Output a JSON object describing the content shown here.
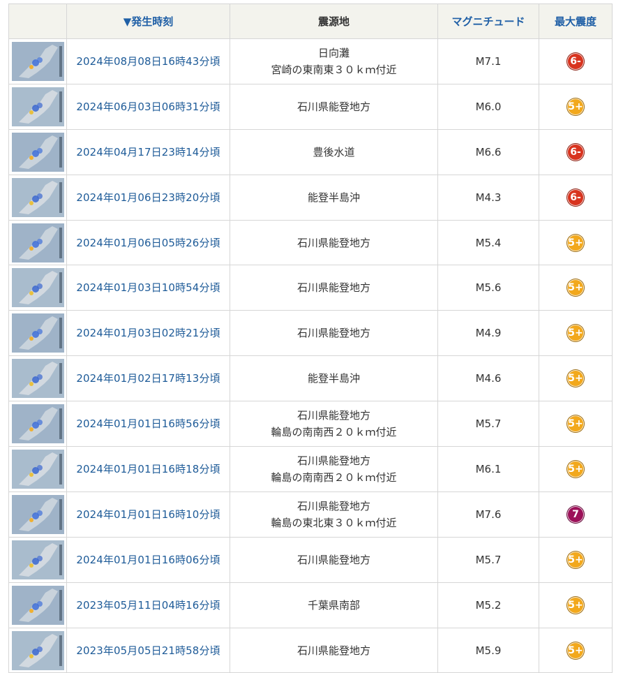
{
  "headers": {
    "thumb": "",
    "time": "▼発生時刻",
    "location": "震源地",
    "magnitude": "マグニチュード",
    "intensity": "最大震度"
  },
  "colors": {
    "6-": "#d8341f",
    "5+": "#f2a81c",
    "7": "#9c1159"
  },
  "rows": [
    {
      "time": "2024年08月08日16時43分頃",
      "location": [
        "日向灘",
        "宮崎の東南東３０ｋｍ付近"
      ],
      "magnitude": "M7.1",
      "intensity": "6-"
    },
    {
      "time": "2024年06月03日06時31分頃",
      "location": [
        "石川県能登地方"
      ],
      "magnitude": "M6.0",
      "intensity": "5+"
    },
    {
      "time": "2024年04月17日23時14分頃",
      "location": [
        "豊後水道"
      ],
      "magnitude": "M6.6",
      "intensity": "6-"
    },
    {
      "time": "2024年01月06日23時20分頃",
      "location": [
        "能登半島沖"
      ],
      "magnitude": "M4.3",
      "intensity": "6-"
    },
    {
      "time": "2024年01月06日05時26分頃",
      "location": [
        "石川県能登地方"
      ],
      "magnitude": "M5.4",
      "intensity": "5+"
    },
    {
      "time": "2024年01月03日10時54分頃",
      "location": [
        "石川県能登地方"
      ],
      "magnitude": "M5.6",
      "intensity": "5+"
    },
    {
      "time": "2024年01月03日02時21分頃",
      "location": [
        "石川県能登地方"
      ],
      "magnitude": "M4.9",
      "intensity": "5+"
    },
    {
      "time": "2024年01月02日17時13分頃",
      "location": [
        "能登半島沖"
      ],
      "magnitude": "M4.6",
      "intensity": "5+"
    },
    {
      "time": "2024年01月01日16時56分頃",
      "location": [
        "石川県能登地方",
        "輪島の南南西２０ｋｍ付近"
      ],
      "magnitude": "M5.7",
      "intensity": "5+"
    },
    {
      "time": "2024年01月01日16時18分頃",
      "location": [
        "石川県能登地方",
        "輪島の南南西２０ｋｍ付近"
      ],
      "magnitude": "M6.1",
      "intensity": "5+"
    },
    {
      "time": "2024年01月01日16時10分頃",
      "location": [
        "石川県能登地方",
        "輪島の東北東３０ｋｍ付近"
      ],
      "magnitude": "M7.6",
      "intensity": "7"
    },
    {
      "time": "2024年01月01日16時06分頃",
      "location": [
        "石川県能登地方"
      ],
      "magnitude": "M5.7",
      "intensity": "5+"
    },
    {
      "time": "2023年05月11日04時16分頃",
      "location": [
        "千葉県南部"
      ],
      "magnitude": "M5.2",
      "intensity": "5+"
    },
    {
      "time": "2023年05月05日21時58分頃",
      "location": [
        "石川県能登地方"
      ],
      "magnitude": "M5.9",
      "intensity": "5+"
    }
  ]
}
